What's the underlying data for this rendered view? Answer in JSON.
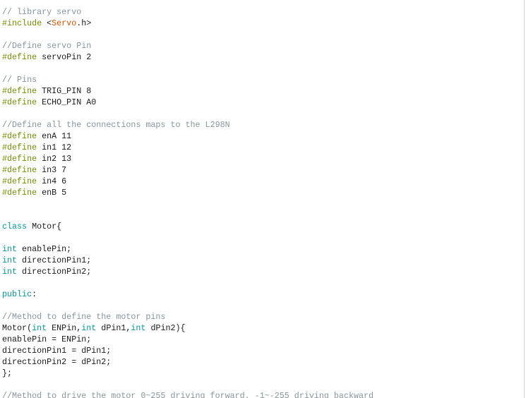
{
  "colors": {
    "comment": "#8a9599",
    "preprocessor": "#728e00",
    "keyword": "#00979c",
    "library": "#d35400",
    "text": "#1a1a1a"
  },
  "lines": [
    [
      [
        "comment",
        "// library servo"
      ]
    ],
    [
      [
        "pre",
        "#include "
      ],
      [
        "plain",
        "<"
      ],
      [
        "lib",
        "Servo"
      ],
      [
        "plain",
        ".h>"
      ]
    ],
    [],
    [
      [
        "comment",
        "//Define servo Pin"
      ]
    ],
    [
      [
        "pre",
        "#define "
      ],
      [
        "plain",
        "servoPin 2"
      ]
    ],
    [],
    [
      [
        "comment",
        "// Pins"
      ]
    ],
    [
      [
        "pre",
        "#define "
      ],
      [
        "plain",
        "TRIG_PIN 8"
      ]
    ],
    [
      [
        "pre",
        "#define "
      ],
      [
        "plain",
        "ECHO_PIN A0"
      ]
    ],
    [],
    [
      [
        "comment",
        "//Define all the connections maps to the L298N"
      ]
    ],
    [
      [
        "pre",
        "#define "
      ],
      [
        "plain",
        "enA 11"
      ]
    ],
    [
      [
        "pre",
        "#define "
      ],
      [
        "plain",
        "in1 12"
      ]
    ],
    [
      [
        "pre",
        "#define "
      ],
      [
        "plain",
        "in2 13"
      ]
    ],
    [
      [
        "pre",
        "#define "
      ],
      [
        "plain",
        "in3 7"
      ]
    ],
    [
      [
        "pre",
        "#define "
      ],
      [
        "plain",
        "in4 6"
      ]
    ],
    [
      [
        "pre",
        "#define "
      ],
      [
        "plain",
        "enB 5"
      ]
    ],
    [],
    [],
    [
      [
        "kw",
        "class"
      ],
      [
        "plain",
        " Motor{"
      ]
    ],
    [],
    [
      [
        "kw",
        "int"
      ],
      [
        "plain",
        " enablePin;"
      ]
    ],
    [
      [
        "kw",
        "int"
      ],
      [
        "plain",
        " directionPin1;"
      ]
    ],
    [
      [
        "kw",
        "int"
      ],
      [
        "plain",
        " directionPin2;"
      ]
    ],
    [],
    [
      [
        "kw",
        "public"
      ],
      [
        "plain",
        ":"
      ]
    ],
    [],
    [
      [
        "comment",
        "//Method to define the motor pins"
      ]
    ],
    [
      [
        "plain",
        "Motor("
      ],
      [
        "kw",
        "int"
      ],
      [
        "plain",
        " ENPin,"
      ],
      [
        "kw",
        "int"
      ],
      [
        "plain",
        " dPin1,"
      ],
      [
        "kw",
        "int"
      ],
      [
        "plain",
        " dPin2){"
      ]
    ],
    [
      [
        "plain",
        "enablePin = ENPin;"
      ]
    ],
    [
      [
        "plain",
        "directionPin1 = dPin1;"
      ]
    ],
    [
      [
        "plain",
        "directionPin2 = dPin2;"
      ]
    ],
    [
      [
        "plain",
        "};"
      ]
    ],
    [],
    [
      [
        "comment",
        "//Method to drive the motor 0~255 driving forward. -1~-255 driving backward"
      ]
    ]
  ]
}
